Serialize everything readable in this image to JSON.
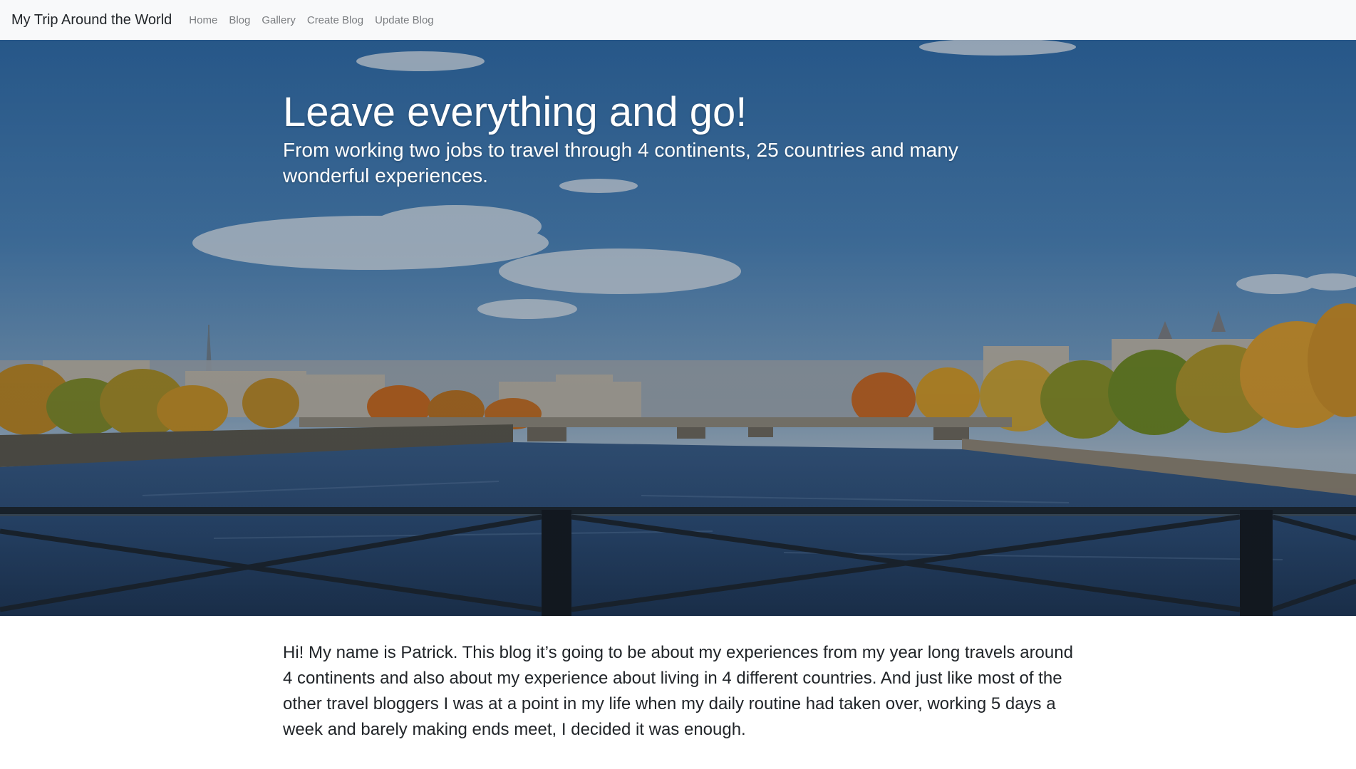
{
  "navbar": {
    "brand": "My Trip Around the World",
    "links": [
      {
        "label": "Home"
      },
      {
        "label": "Blog"
      },
      {
        "label": "Gallery"
      },
      {
        "label": "Create Blog"
      },
      {
        "label": "Update Blog"
      }
    ]
  },
  "hero": {
    "title": "Leave everything and go!",
    "subtitle": "From working two jobs to travel through 4 continents, 25 countries and many wonderful experiences.",
    "background": "photo of the Seine river in Paris with bridges, autumn trees and a railing in the foreground"
  },
  "content": {
    "intro": "Hi! My name is Patrick. This blog it’s going to be about my experiences from my year long travels around 4 continents and also about my experience about living in 4 different countries. And just like most of the other travel bloggers I was at a point in my life when my daily routine had taken over, working 5 days a week and barely making ends meet, I decided it was enough."
  },
  "colors": {
    "navbar_bg": "#f8f9fa",
    "brand_text": "#212529",
    "nav_link": "#7a7d80",
    "hero_text": "#ffffff",
    "body_text": "#212529"
  }
}
